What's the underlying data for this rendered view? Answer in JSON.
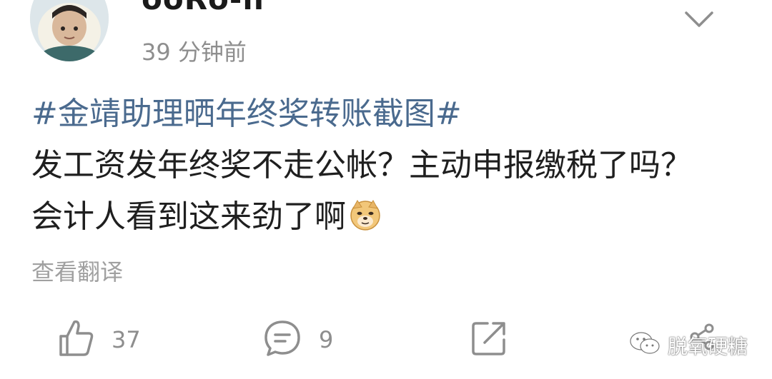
{
  "post": {
    "username": "ooRo-ii",
    "timestamp": "39 分钟前",
    "topic": "#金靖助理晒年终奖转账截图#",
    "text": "发工资发年终奖不走公帐？主动申报缴税了吗？会计人看到这来劲了啊",
    "emoji": "doge-emoji",
    "translate_label": "查看翻译"
  },
  "actions": {
    "like_count": "37",
    "comment_count": "9",
    "share_icon": "share-icon"
  },
  "watermark": {
    "text": "脱氧硬糖"
  },
  "colors": {
    "topic_link": "#4a6a8e",
    "secondary_text": "#8e8e8e"
  }
}
